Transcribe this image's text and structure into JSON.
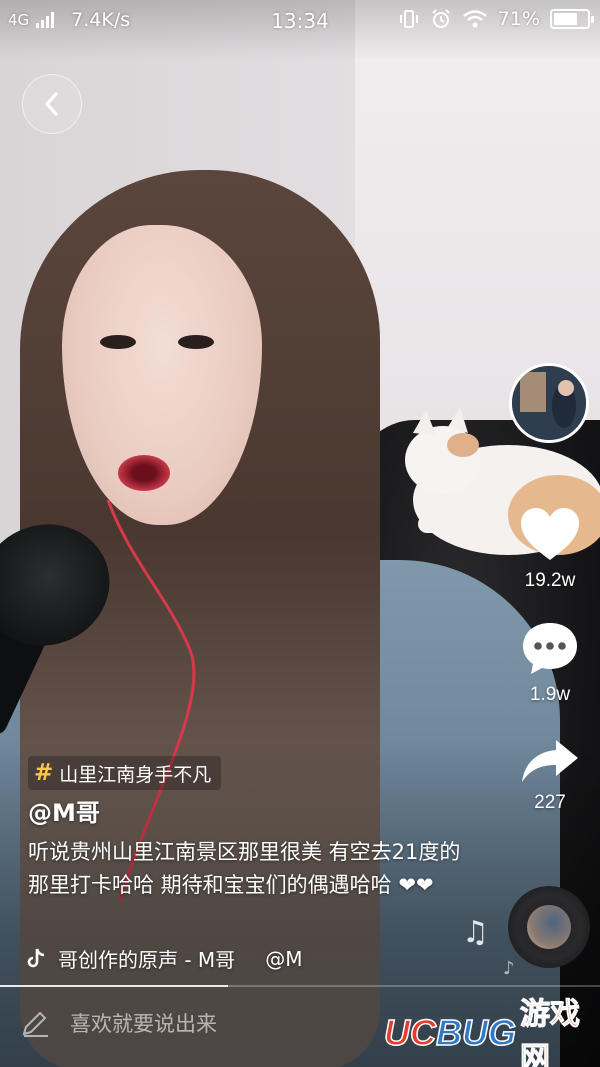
{
  "status_bar": {
    "network": "4G",
    "speed": "7.4K/s",
    "time": "13:34",
    "battery_percent": "71%",
    "battery_level": 0.71,
    "icons": [
      "signal-icon",
      "vibrate-icon",
      "alarm-icon",
      "wifi-icon",
      "battery-icon"
    ]
  },
  "nav": {
    "back_icon": "chevron-left-icon"
  },
  "actions": {
    "like_count": "19.2w",
    "comment_count": "1.9w",
    "share_count": "227"
  },
  "video": {
    "hashtag": "山里江南身手不凡",
    "author": "@M哥",
    "description": "听说贵州山里江南景区那里很美  有空去21度的那里打卡哈哈 期待和宝宝们的偶遇哈哈 ❤❤",
    "music": "哥创作的原声 - M哥",
    "music_mention": "@M",
    "progress": 0.38
  },
  "comment": {
    "placeholder": "喜欢就要说出来"
  },
  "watermark": {
    "part1": "UC",
    "part2": "BUG",
    "part3": "游戏网"
  },
  "colors": {
    "hashtag_accent": "#f6c945",
    "watermark_red": "#e63b2e",
    "watermark_blue": "#2f79c9"
  }
}
